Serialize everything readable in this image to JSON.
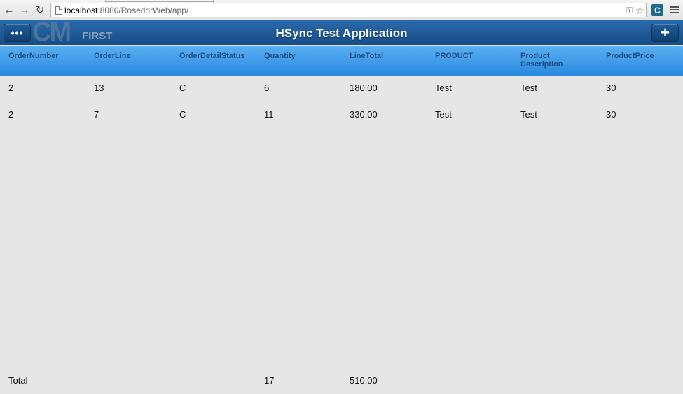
{
  "browser": {
    "url_host": "localhost",
    "url_rest": ":8080/RosedorWeb/app/"
  },
  "header": {
    "title": "HSync Test Application",
    "more_label": "•••",
    "add_label": "+",
    "logo_text": "CM",
    "logo_sub": "FIRST"
  },
  "table": {
    "columns": [
      "OrderNumber",
      "OrderLine",
      "OrderDetailStatus",
      "Quantity",
      "LineTotal",
      "PRODUCT",
      "Product Description",
      "ProductPrice"
    ],
    "rows": [
      [
        "2",
        "13",
        "C",
        "6",
        "180.00",
        "Test",
        "Test",
        "30"
      ],
      [
        "2",
        "7",
        "C",
        "11",
        "330.00",
        "Test",
        "Test",
        "30"
      ]
    ],
    "footer": {
      "label": "Total",
      "quantity": "17",
      "line_total": "510.00"
    }
  }
}
